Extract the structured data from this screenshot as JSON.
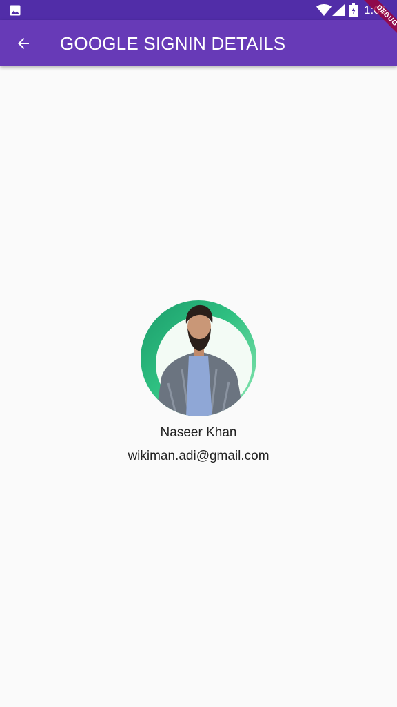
{
  "status_bar": {
    "time": "1:01",
    "icons": [
      "gallery-icon",
      "wifi-icon",
      "signal-icon",
      "battery-icon"
    ]
  },
  "app_bar": {
    "title": "GOOGLE SIGNIN DETAILS",
    "back_icon": "arrow-back-icon",
    "color": "#673ab7",
    "status_color": "#512da8"
  },
  "debug_banner": {
    "label": "DEBUG"
  },
  "profile": {
    "name": "Naseer Khan",
    "email": "wikiman.adi@gmail.com",
    "avatar_icon": "profile-photo"
  }
}
